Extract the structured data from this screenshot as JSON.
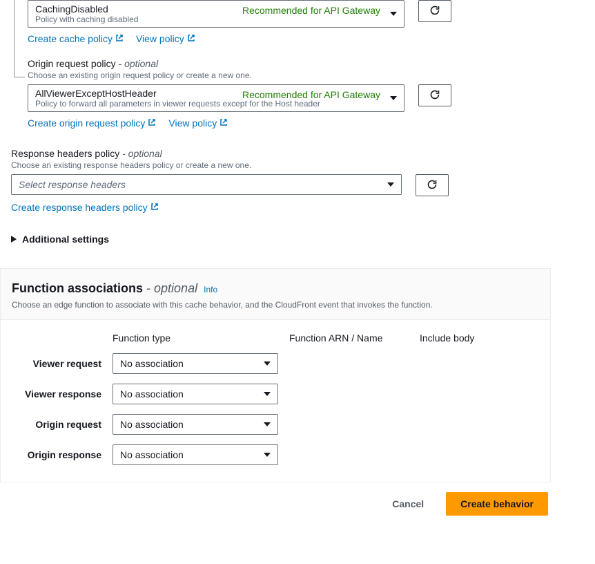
{
  "cachePolicy": {
    "selected": "CachingDisabled",
    "selectedDesc": "Policy with caching disabled",
    "badge": "Recommended for API Gateway",
    "createLink": "Create cache policy",
    "viewLink": "View policy"
  },
  "originRequestPolicy": {
    "label": "Origin request policy",
    "optional": " - optional",
    "desc": "Choose an existing origin request policy or create a new one.",
    "selected": "AllViewerExceptHostHeader",
    "selectedDesc": "Policy to forward all parameters in viewer requests except for the Host header",
    "badge": "Recommended for API Gateway",
    "createLink": "Create origin request policy",
    "viewLink": "View policy"
  },
  "responseHeadersPolicy": {
    "label": "Response headers policy",
    "optional": " - optional",
    "desc": "Choose an existing response headers policy or create a new one.",
    "placeholder": "Select response headers",
    "createLink": "Create response headers policy"
  },
  "additionalSettings": "Additional settings",
  "functionAssociations": {
    "title": "Function associations",
    "optional": " - optional",
    "info": "Info",
    "desc": "Choose an edge function to associate with this cache behavior, and the CloudFront event that invokes the function.",
    "headers": {
      "functionType": "Function type",
      "functionArn": "Function ARN / Name",
      "includeBody": "Include body"
    },
    "rows": [
      {
        "label": "Viewer request",
        "value": "No association"
      },
      {
        "label": "Viewer response",
        "value": "No association"
      },
      {
        "label": "Origin request",
        "value": "No association"
      },
      {
        "label": "Origin response",
        "value": "No association"
      }
    ]
  },
  "buttons": {
    "cancel": "Cancel",
    "create": "Create behavior"
  }
}
